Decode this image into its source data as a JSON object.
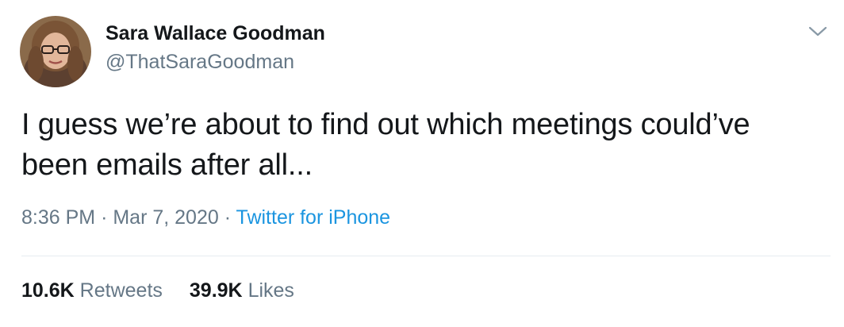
{
  "author": {
    "display_name": "Sara Wallace Goodman",
    "handle": "@ThatSaraGoodman"
  },
  "tweet": {
    "text": "I guess we’re about to find out which meetings could’ve been emails after all...",
    "time": "8:36 PM",
    "date": "Mar 7, 2020",
    "separator": "·",
    "source": "Twitter for iPhone"
  },
  "stats": {
    "retweets_count": "10.6K",
    "retweets_label": "Retweets",
    "likes_count": "39.9K",
    "likes_label": "Likes"
  },
  "icons": {
    "menu": "chevron-down-icon"
  },
  "colors": {
    "text_primary": "#14171a",
    "text_secondary": "#657786",
    "link": "#1b95e0",
    "divider": "#e6ecf0"
  }
}
